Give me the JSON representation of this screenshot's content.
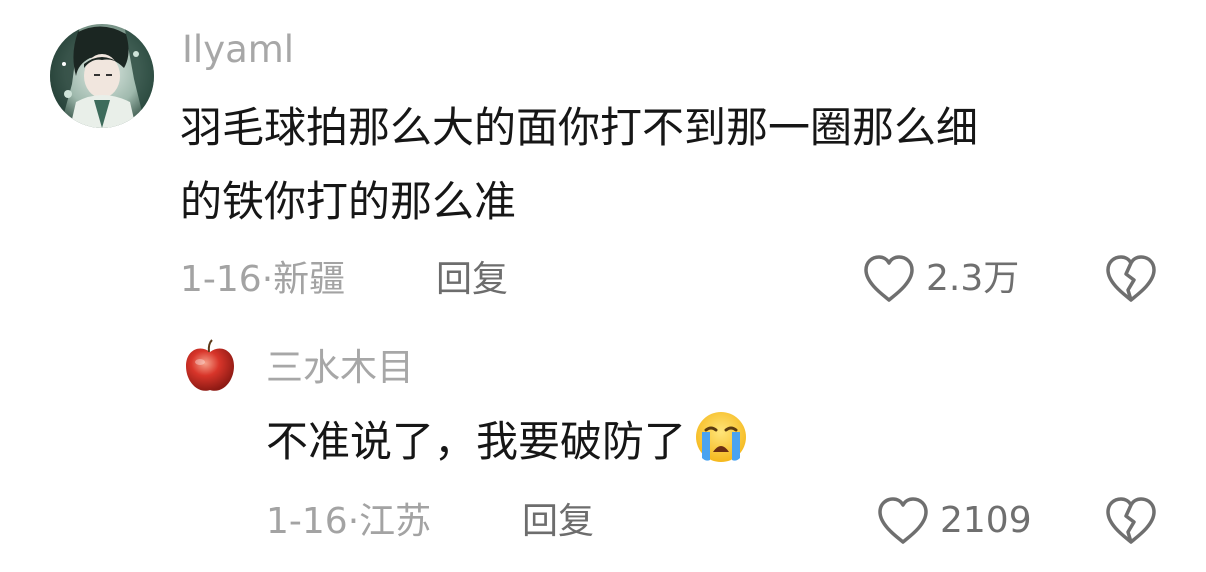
{
  "comments": [
    {
      "username": "Ilyaml",
      "text_line1": "羽毛球拍那么大的面你打不到那一圈那么细",
      "text_line2": "的铁你打的那么准",
      "date": "1-16",
      "location": "新疆",
      "reply_label": "回复",
      "likes": "2.3万",
      "avatar": "anime-character-avatar"
    },
    {
      "username": "三水木目",
      "text": "不准说了，我要破防了",
      "emoji": "loudly-crying-face-emoji",
      "date": "1-16",
      "location": "江苏",
      "reply_label": "回复",
      "likes": "2109",
      "avatar": "red-apple-avatar"
    }
  ],
  "colors": {
    "text": "#161616",
    "secondary": "#a7a7a7",
    "reply": "#6d6d6d",
    "icon": "#6f6f6f"
  },
  "icons": {
    "like": "heart-outline-icon",
    "dislike": "broken-heart-outline-icon"
  }
}
